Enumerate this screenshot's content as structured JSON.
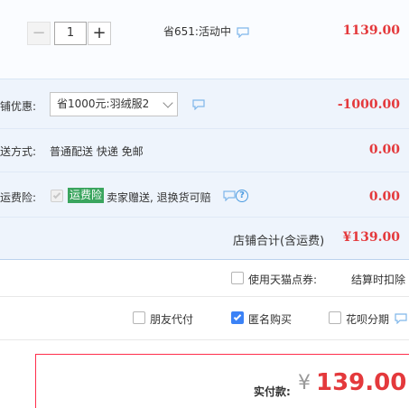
{
  "item": {
    "qty_minus": "−",
    "qty_value": "1",
    "qty_plus": "+",
    "promo_status": "省651:活动中",
    "subtotal": "1139.00"
  },
  "discount": {
    "label": "铺优惠:",
    "selected_option": "省1000元:羽绒服2",
    "amount": "-1000.00"
  },
  "shipping": {
    "label": "送方式:",
    "method": "普通配送 快递 免邮",
    "amount": "0.00"
  },
  "insurance": {
    "label": "运费险:",
    "badge": "运费险",
    "desc": "卖家赠送, 退换货可赔",
    "help": "?",
    "amount": "0.00"
  },
  "shop_total": {
    "label": "店铺合计(含运费)",
    "amount": "¥139.00"
  },
  "points": {
    "label": "使用天猫点券:",
    "note": "结算时扣除"
  },
  "options": {
    "friend_pay": "朋友代付",
    "anonymous": "匿名购买",
    "huabei": "花呗分期"
  },
  "payment": {
    "label": "实付款:",
    "currency": "¥",
    "amount": "139.00"
  },
  "colors": {
    "price_red": "#e4393c",
    "accent_blue": "#3b82f6",
    "badge_green": "#3aa55e"
  }
}
